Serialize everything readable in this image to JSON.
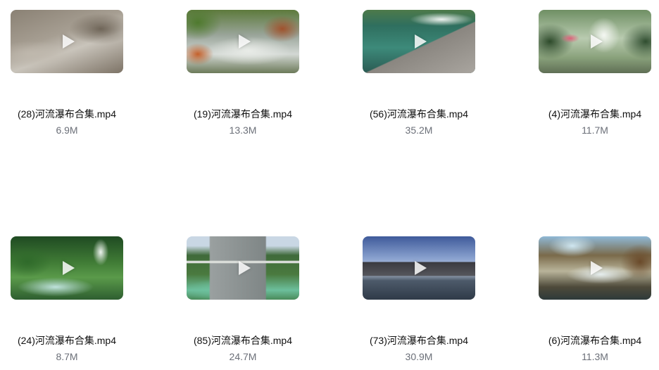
{
  "files": [
    {
      "name": "(28)河流瀑布合集.mp4",
      "size": "6.9M",
      "thumb": "rocky-stream"
    },
    {
      "name": "(19)河流瀑布合集.mp4",
      "size": "13.3M",
      "thumb": "mountain-creek"
    },
    {
      "name": "(56)河流瀑布合集.mp4",
      "size": "35.2M",
      "thumb": "weir-cascade"
    },
    {
      "name": "(4)河流瀑布合集.mp4",
      "size": "11.7M",
      "thumb": "forest-waterfall"
    },
    {
      "name": "(24)河流瀑布合集.mp4",
      "size": "8.7M",
      "thumb": "jungle-waterfall"
    },
    {
      "name": "(85)河流瀑布合集.mp4",
      "size": "24.7M",
      "thumb": "dam"
    },
    {
      "name": "(73)河流瀑布合集.mp4",
      "size": "30.9M",
      "thumb": "city-river"
    },
    {
      "name": "(6)河流瀑布合集.mp4",
      "size": "11.3M",
      "thumb": "terraced-falls"
    }
  ],
  "icons": {
    "play": "play-icon"
  }
}
